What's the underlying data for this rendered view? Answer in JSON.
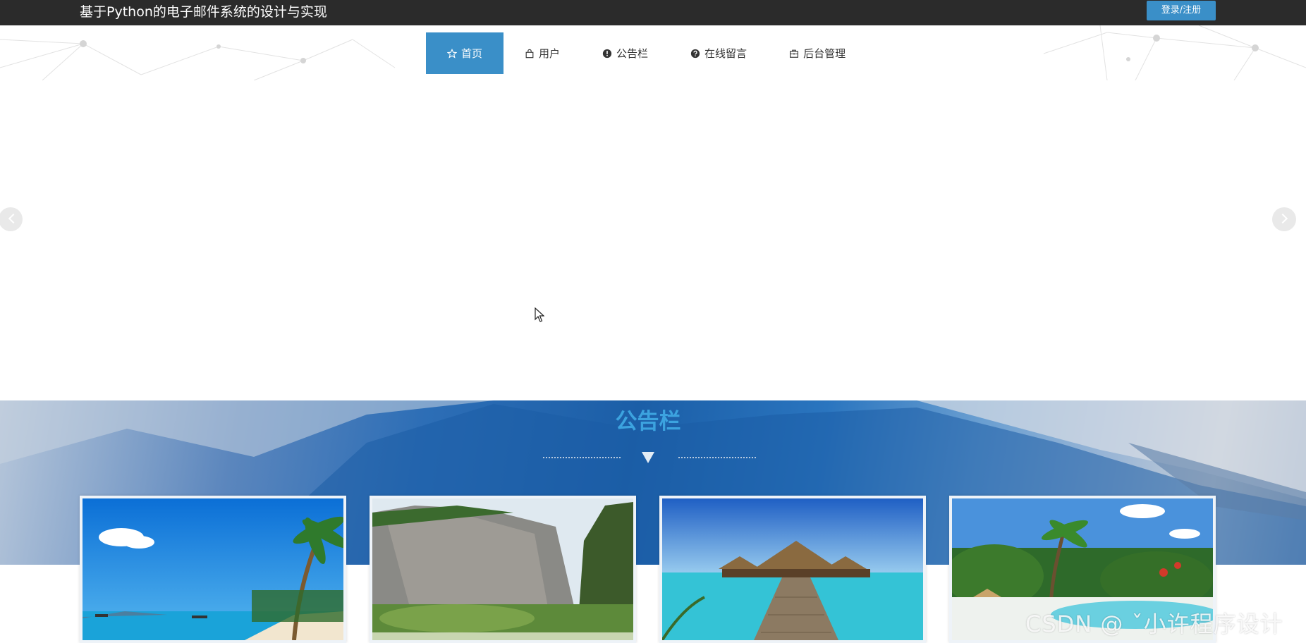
{
  "header": {
    "site_title": "基于Python的电子邮件系统的设计与实现",
    "login_label": "登录/注册"
  },
  "nav": {
    "items": [
      {
        "label": "首页",
        "icon": "star-icon",
        "active": true
      },
      {
        "label": "用户",
        "icon": "bag-icon",
        "active": false
      },
      {
        "label": "公告栏",
        "icon": "exclamation-circle-icon",
        "active": false
      },
      {
        "label": "在线留言",
        "icon": "question-circle-icon",
        "active": false
      },
      {
        "label": "后台管理",
        "icon": "briefcase-icon",
        "active": false
      }
    ]
  },
  "banner": {
    "prev_icon": "chevron-left-icon",
    "next_icon": "chevron-right-icon"
  },
  "notice": {
    "title": "公告栏",
    "cards": [
      {
        "image": "tropical-beach-palm"
      },
      {
        "image": "cliff-lake"
      },
      {
        "image": "overwater-bungalow-pier"
      },
      {
        "image": "resort-pool-palms"
      }
    ]
  },
  "watermark": "CSDN @ ˇ小许程序设计",
  "colors": {
    "accent": "#3a8fc8",
    "topbar": "#2b2b2b",
    "section_title": "#3ca3df"
  }
}
